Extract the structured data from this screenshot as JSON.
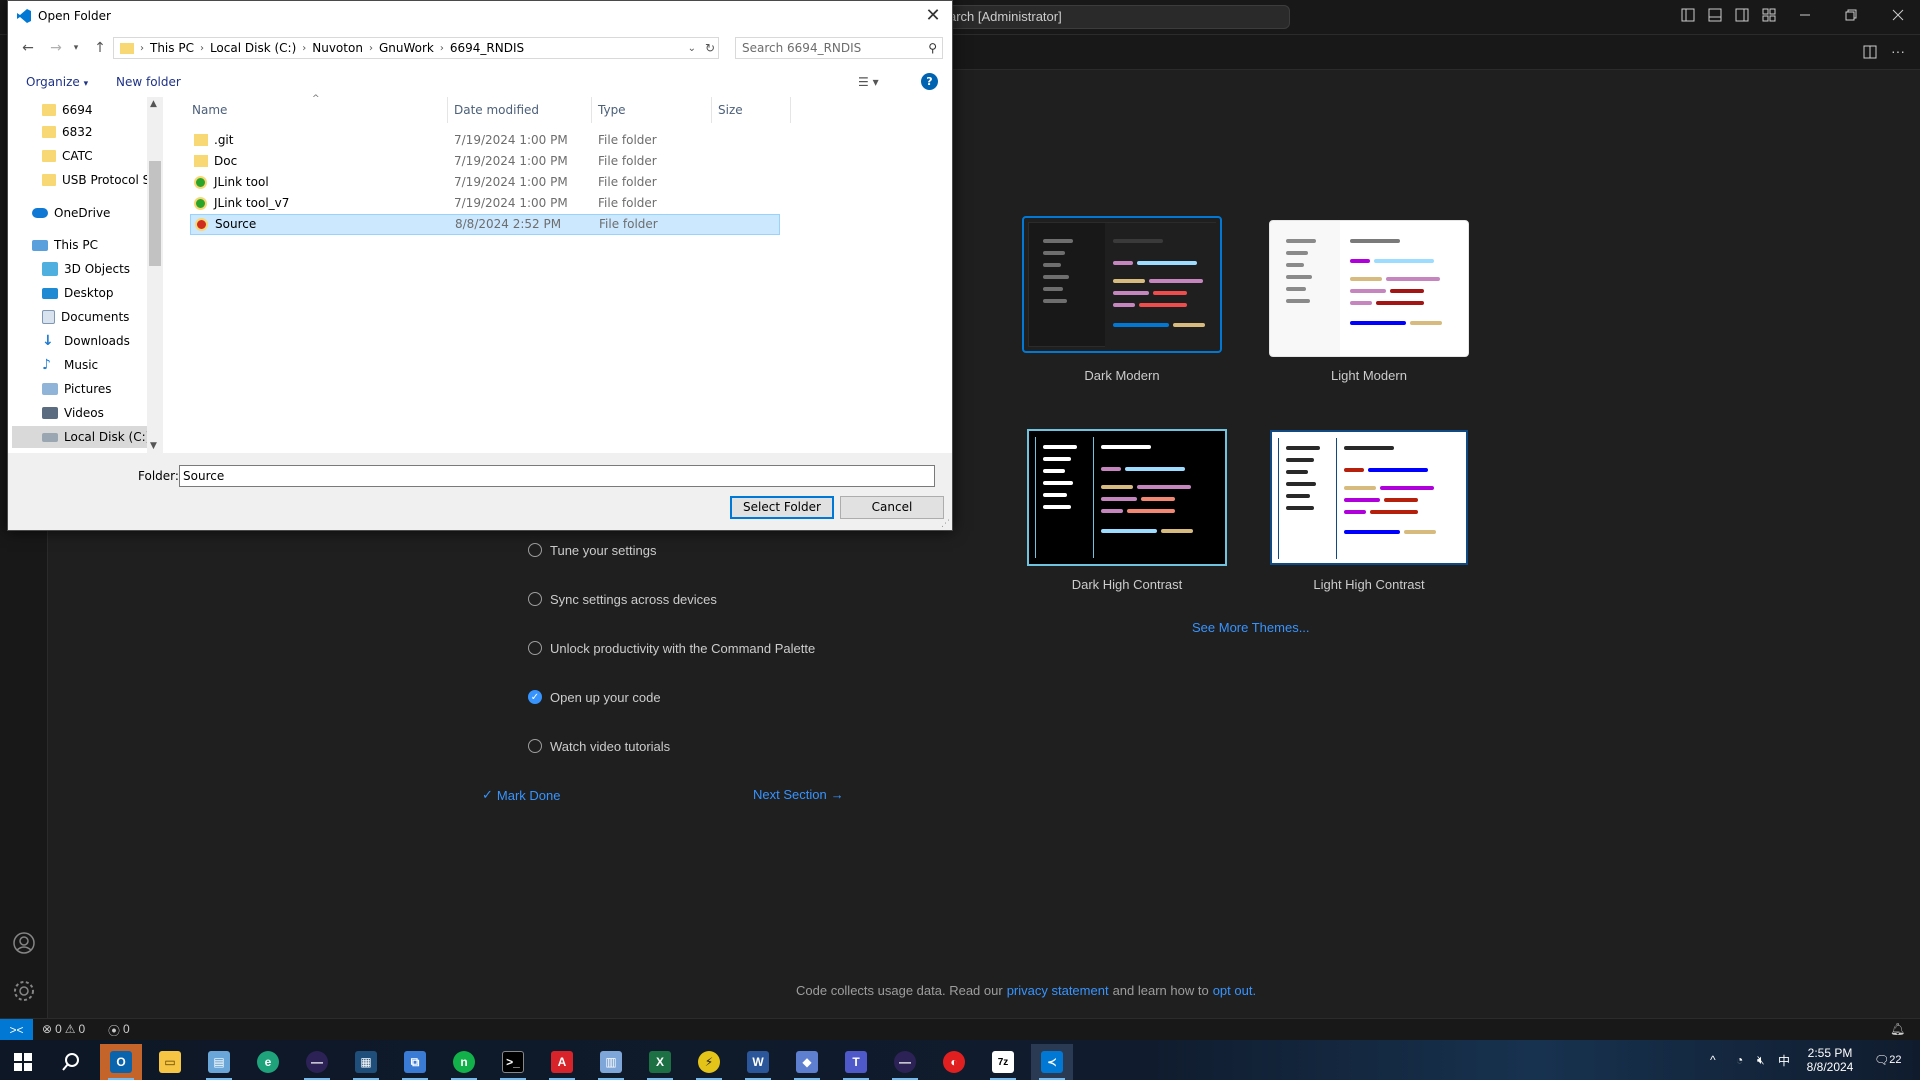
{
  "vscode": {
    "search_text": "arch [Administrator]",
    "walkthrough_steps": [
      {
        "label": "Tune your settings",
        "done": false
      },
      {
        "label": "Sync settings across devices",
        "done": false
      },
      {
        "label": "Unlock productivity with the Command Palette",
        "done": false
      },
      {
        "label": "Open up your code",
        "done": true
      },
      {
        "label": "Watch video tutorials",
        "done": false
      }
    ],
    "mark_done": "Mark Done",
    "next_section": "Next Section",
    "themes": [
      {
        "name": "Dark Modern",
        "selected": true
      },
      {
        "name": "Light Modern",
        "selected": false
      },
      {
        "name": "Dark High Contrast",
        "selected": false
      },
      {
        "name": "Light High Contrast",
        "selected": false
      }
    ],
    "see_more_themes": "See More Themes...",
    "telemetry": {
      "prefix": "Code collects usage data. Read our",
      "privacy_link": "privacy statement",
      "middle": "and learn how to",
      "opt_out_link": "opt out."
    },
    "status": {
      "errors": "0",
      "warnings": "0",
      "ports": "0"
    },
    "accent_color": "#0078d4",
    "link_color": "#3794ff"
  },
  "dialog": {
    "title": "Open Folder",
    "breadcrumbs": [
      "This PC",
      "Local Disk (C:)",
      "Nuvoton",
      "GnuWork",
      "6694_RNDIS"
    ],
    "search_placeholder": "Search 6694_RNDIS",
    "organize": "Organize",
    "new_folder": "New folder",
    "nav_items": [
      {
        "label": "6694",
        "icon": "folder-icon"
      },
      {
        "label": "6832",
        "icon": "folder-icon"
      },
      {
        "label": "CATC",
        "icon": "folder-icon"
      },
      {
        "label": "USB Protocol Su",
        "icon": "folder-icon"
      },
      {
        "label": "OneDrive",
        "icon": "cloud-icon"
      },
      {
        "label": "This PC",
        "icon": "computer-icon"
      },
      {
        "label": "3D Objects",
        "icon": "cube-icon"
      },
      {
        "label": "Desktop",
        "icon": "desktop-icon"
      },
      {
        "label": "Documents",
        "icon": "document-icon"
      },
      {
        "label": "Downloads",
        "icon": "download-icon"
      },
      {
        "label": "Music",
        "icon": "music-icon"
      },
      {
        "label": "Pictures",
        "icon": "picture-icon"
      },
      {
        "label": "Videos",
        "icon": "video-icon"
      },
      {
        "label": "Local Disk (C:)",
        "icon": "drive-icon"
      }
    ],
    "columns": [
      "Name",
      "Date modified",
      "Type",
      "Size"
    ],
    "files": [
      {
        "name": ".git",
        "date": "7/19/2024 1:00 PM",
        "type": "File folder",
        "icon": "folder-icon"
      },
      {
        "name": "Doc",
        "date": "7/19/2024 1:00 PM",
        "type": "File folder",
        "icon": "folder-icon"
      },
      {
        "name": "JLink tool",
        "date": "7/19/2024 1:00 PM",
        "type": "File folder",
        "icon": "git-ok-icon"
      },
      {
        "name": "JLink tool_v7",
        "date": "7/19/2024 1:00 PM",
        "type": "File folder",
        "icon": "git-ok-icon"
      },
      {
        "name": "Source",
        "date": "8/8/2024 2:52 PM",
        "type": "File folder",
        "icon": "git-modified-icon"
      }
    ],
    "folder_label": "Folder:",
    "folder_value": "Source",
    "select_button": "Select Folder",
    "cancel_button": "Cancel"
  },
  "taskbar": {
    "ime": "中",
    "time": "2:55 PM",
    "date": "8/8/2024",
    "notifications": "22"
  }
}
